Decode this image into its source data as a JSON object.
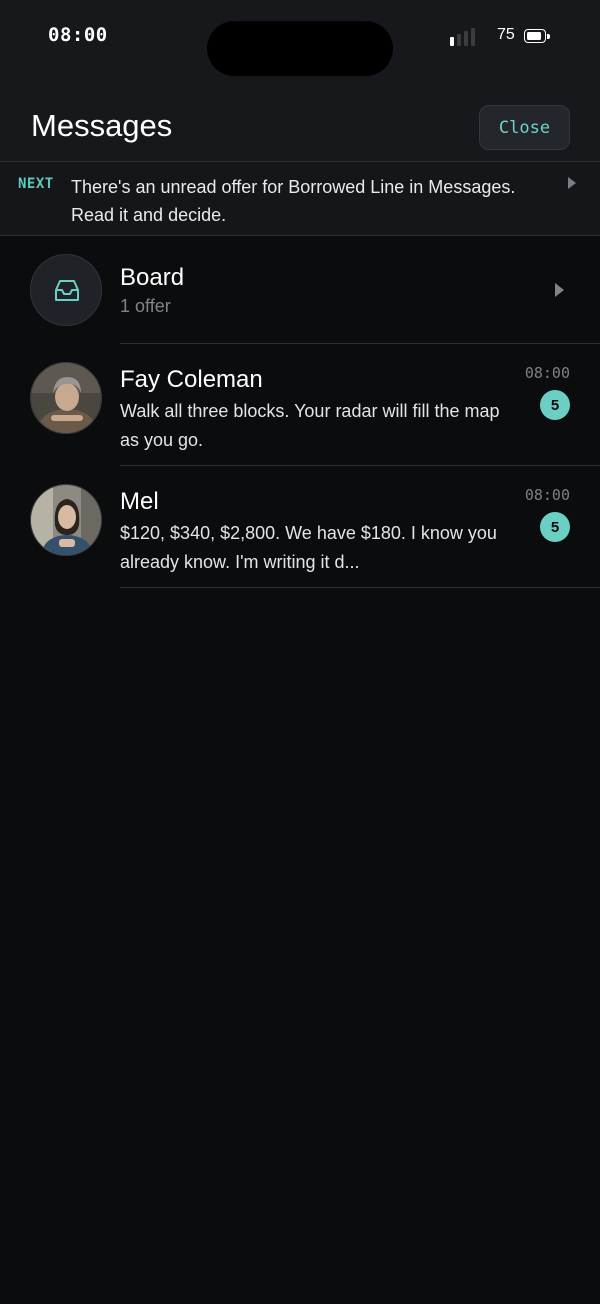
{
  "status_bar": {
    "time": "08:00",
    "battery_percent": "75",
    "signal_bars_on": 1,
    "signal_bars_total": 4
  },
  "header": {
    "title": "Messages",
    "close_label": "Close"
  },
  "next_banner": {
    "tag": "NEXT",
    "text": "There's an unread offer for Borrowed Line in Messages. Read it and decide."
  },
  "board": {
    "title": "Board",
    "subtitle": "1 offer",
    "icon": "inbox-tray-icon"
  },
  "conversations": [
    {
      "name": "Fay Coleman",
      "preview": "Walk all three blocks. Your radar will fill the map as you go.",
      "time": "08:00",
      "unread": "5"
    },
    {
      "name": "Mel",
      "preview": "$120, $340, $2,800. We have $180. I know you already know. I'm writing it d...",
      "time": "08:00",
      "unread": "5"
    }
  ],
  "colors": {
    "accent": "#6ad0c3",
    "background": "#0b0c0e",
    "header_bg": "#17181b"
  }
}
